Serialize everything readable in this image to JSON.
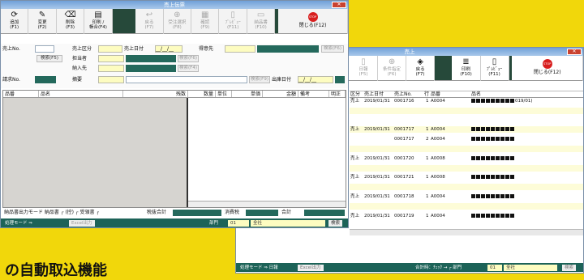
{
  "colors": {
    "page_bg": "#f1d70b",
    "dark_green": "#24695c",
    "status_green": "#1d6358",
    "input_yellow": "#fdfcc0",
    "title_blue": "#6fa0d8"
  },
  "caption": "の自動取込機能",
  "win1": {
    "title": "売上伝票",
    "toolbar": [
      {
        "icon": "add-icon",
        "glyph": "⟳",
        "label": "追加",
        "key": "(F1)",
        "enabled": true
      },
      {
        "icon": "edit-icon",
        "glyph": "✎",
        "label": "変更",
        "key": "(F2)",
        "enabled": true
      },
      {
        "icon": "delete-icon",
        "glyph": "⌫",
        "label": "削除",
        "key": "(F3)",
        "enabled": true
      },
      {
        "icon": "print-icon",
        "glyph": "▤",
        "label": "印刷 /",
        "label2": "帳合(F4)",
        "enabled": true
      },
      {
        "icon": "back-icon",
        "glyph": "↩",
        "label": "戻る",
        "key": "(F7)",
        "enabled": false
      },
      {
        "icon": "order-select-icon",
        "glyph": "⊕",
        "label": "受注選択",
        "key": "(F8)",
        "enabled": false
      },
      {
        "icon": "confirm-icon",
        "glyph": "▦",
        "label": "確認",
        "key": "(F9)",
        "enabled": false
      },
      {
        "icon": "preview-icon",
        "glyph": "▯",
        "label": "ﾌﾟﾚﾋﾞｭｰ",
        "key": "(F11)",
        "enabled": false
      },
      {
        "icon": "delivery-slip-icon",
        "glyph": "▭",
        "label": "納品書",
        "key": "(F10)",
        "enabled": false
      }
    ],
    "stop_label": "STOP",
    "close_label": "閉じる(F12)",
    "form": {
      "sales_no": "売上No.",
      "sales_type": "売上区分",
      "sales_date": "売上日付",
      "sales_date_val": "__/__/__",
      "customer": "得意先",
      "search_f5": "検索(F5)",
      "search_f6": "検索(F6)",
      "staff": "担当者",
      "delivery_to": "納入先",
      "search_f4": "検索(F4)",
      "deposit_no": "請求No.",
      "summary": "摘要",
      "search_f9": "検索(F9)",
      "ship_date": "出庫日付",
      "ship_date_val": "__/__/__"
    },
    "columns": [
      "品番",
      "品名",
      "残数",
      "数量",
      "単位",
      "単価",
      "金額",
      "備考",
      "明正"
    ],
    "footer": {
      "left": "納品書出力モード 納品書 ┌ (控) ┌ 受領書 ┌",
      "sales_total": "税抜合計",
      "tax": "消費税",
      "total": "合計",
      "mode": "処理モード ⇒",
      "excel": "Excel出力",
      "dept": "部門",
      "dept_code": "01",
      "dept_name": "全社",
      "search": "検索"
    }
  },
  "win2": {
    "title": "売上",
    "toolbar": [
      {
        "icon": "daily-icon",
        "glyph": "▯",
        "label": "日報",
        "key": "(F5)",
        "enabled": false
      },
      {
        "icon": "condition-icon",
        "glyph": "⊕",
        "label": "条件指定",
        "key": "(F6)",
        "enabled": false
      },
      {
        "icon": "back-icon",
        "glyph": "◈",
        "label": "戻る",
        "key": "(F7)",
        "enabled": true
      },
      {
        "icon": "print-icon",
        "glyph": "≣",
        "label": "印刷",
        "key": "(F10)",
        "enabled": true
      },
      {
        "icon": "preview-icon",
        "glyph": "▯",
        "label": "ﾌﾟﾚﾋﾞｭｰ",
        "key": "(F11)",
        "enabled": true
      }
    ],
    "stop_label": "STOP",
    "close_label": "閉じる(F12)",
    "columns": [
      "区分",
      "売上日付",
      "売上No.",
      "行",
      "品番",
      "品名"
    ],
    "rows": [
      {
        "type": "売上",
        "date": "2019/01/31",
        "no": "0001716",
        "line": "1",
        "code": "A0004",
        "name_tail": "019/01)"
      },
      {
        "type": "",
        "date": "",
        "no": "",
        "line": "",
        "code": "",
        "name_tail": ""
      },
      {
        "type": "",
        "date": "",
        "no": "",
        "line": "",
        "code": "",
        "name_tail": ""
      },
      {
        "type": "売上",
        "date": "2019/01/31",
        "no": "0001717",
        "line": "1",
        "code": "A0004",
        "name_tail": ""
      },
      {
        "type": "",
        "date": "",
        "no": "0001717",
        "line": "2",
        "code": "A0004",
        "name_tail": ""
      },
      {
        "type": "",
        "date": "",
        "no": "",
        "line": "",
        "code": "",
        "name_tail": ""
      },
      {
        "type": "売上",
        "date": "2019/01/31",
        "no": "0001720",
        "line": "1",
        "code": "A0008",
        "name_tail": ""
      },
      {
        "type": "",
        "date": "",
        "no": "",
        "line": "",
        "code": "",
        "name_tail": ""
      },
      {
        "type": "売上",
        "date": "2019/01/31",
        "no": "0001721",
        "line": "1",
        "code": "A0008",
        "name_tail": ""
      },
      {
        "type": "",
        "date": "",
        "no": "",
        "line": "",
        "code": "",
        "name_tail": ""
      },
      {
        "type": "売上",
        "date": "2019/01/31",
        "no": "0001718",
        "line": "1",
        "code": "A0004",
        "name_tail": ""
      },
      {
        "type": "",
        "date": "",
        "no": "",
        "line": "",
        "code": "",
        "name_tail": ""
      },
      {
        "type": "売上",
        "date": "2019/01/31",
        "no": "0001719",
        "line": "1",
        "code": "A0004",
        "name_tail": ""
      }
    ],
    "footer": {
      "mode": "処理モード ⇒ 日報",
      "excel": "Excel出力",
      "check": "合計時：ﾁｪｯｸ → ┌ 部門",
      "dept_code": "01",
      "dept_name": "全社",
      "search": "検索"
    }
  }
}
